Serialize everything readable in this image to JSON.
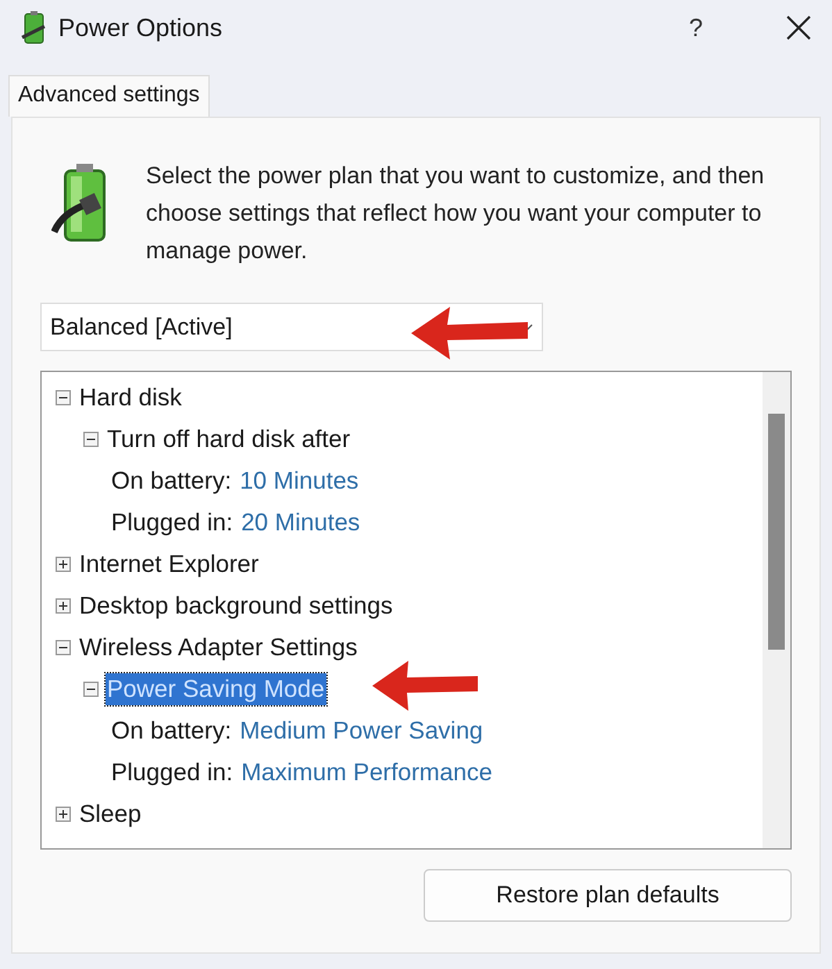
{
  "window": {
    "title": "Power Options",
    "help": "?"
  },
  "tabs": [
    {
      "label": "Advanced settings",
      "selected": true
    }
  ],
  "intro": "Select the power plan that you want to customize, and then choose settings that reflect how you want your computer to manage power.",
  "plan_dropdown": {
    "value": "Balanced [Active]"
  },
  "tree": [
    {
      "kind": "group",
      "label": "Hard disk",
      "expanded": true,
      "selected": false,
      "children": [
        {
          "kind": "group",
          "label": "Turn off hard disk after",
          "expanded": true,
          "selected": false,
          "children": [
            {
              "kind": "setting",
              "label": "On battery:",
              "value": "10 Minutes"
            },
            {
              "kind": "setting",
              "label": "Plugged in:",
              "value": "20 Minutes"
            }
          ]
        }
      ]
    },
    {
      "kind": "group",
      "label": "Internet Explorer",
      "expanded": false,
      "selected": false
    },
    {
      "kind": "group",
      "label": "Desktop background settings",
      "expanded": false,
      "selected": false
    },
    {
      "kind": "group",
      "label": "Wireless Adapter Settings",
      "expanded": true,
      "selected": false,
      "children": [
        {
          "kind": "group",
          "label": "Power Saving Mode",
          "expanded": true,
          "selected": true,
          "children": [
            {
              "kind": "setting",
              "label": "On battery:",
              "value": "Medium Power Saving"
            },
            {
              "kind": "setting",
              "label": "Plugged in:",
              "value": "Maximum Performance"
            }
          ]
        }
      ]
    },
    {
      "kind": "group",
      "label": "Sleep",
      "expanded": false,
      "selected": false
    }
  ],
  "buttons": [
    "Restore plan defaults"
  ]
}
